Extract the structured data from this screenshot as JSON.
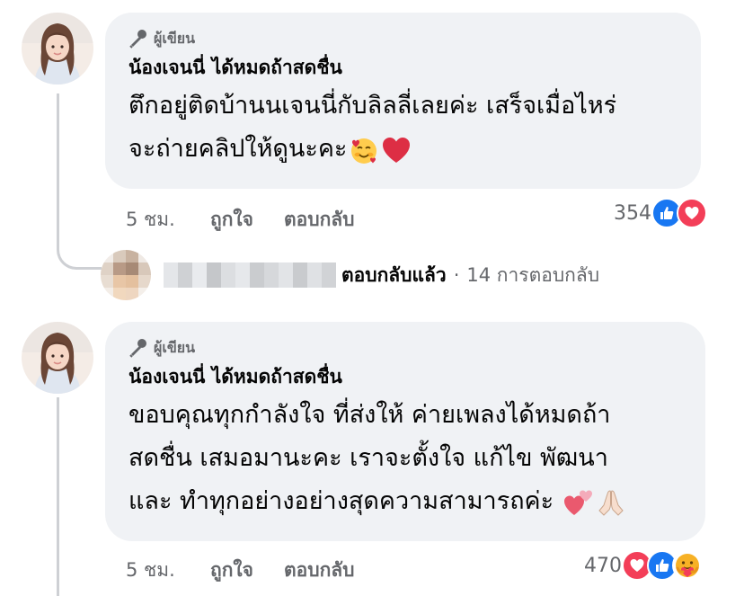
{
  "comments": [
    {
      "author_badge": "ผู้เขียน",
      "author_name": "น้องเจนนี่ ได้หมดถ้าสดชื่น",
      "text_line1": "ตึกอยู่ติดบ้านนเจนนี่กับลิลลี่เลยค่ะ  เสร็จเมื่อไหร่",
      "text_line2": "จะถ่ายคลิปให้ดูนะคะ",
      "emojis": [
        "smiling-face-with-hearts",
        "red-heart"
      ],
      "timestamp": "5 ชม.",
      "like_label": "ถูกใจ",
      "reply_label": "ตอบกลับ",
      "reaction_count": "354",
      "reactions": [
        "like",
        "love"
      ]
    },
    {
      "author_badge": "ผู้เขียน",
      "author_name": "น้องเจนนี่ ได้หมดถ้าสดชื่น",
      "text_line1": "ขอบคุณทุกกำลังใจ ที่ส่งให้ ค่ายเพลงได้หมดถ้า",
      "text_line2": "สดชื่น เสมอมานะคะ เราจะตั้งใจ แก้ไข พัฒนา",
      "text_line3": "และ ทำทุกอย่างอย่างสุดความสามารถค่ะ",
      "emojis": [
        "two-hearts",
        "folded-hands"
      ],
      "timestamp": "5 ชม.",
      "like_label": "ถูกใจ",
      "reply_label": "ตอบกลับ",
      "reaction_count": "470",
      "reactions": [
        "love",
        "like",
        "care"
      ]
    }
  ],
  "reply_summary": {
    "replied_label": "ตอบกลับแล้ว",
    "separator": "·",
    "replies_count_label": "14 การตอบกลับ"
  },
  "colors": {
    "bubble_bg": "#f0f2f5",
    "secondary_text": "#65676b",
    "primary_text": "#050505",
    "like_blue": "#1877f2",
    "love_red": "#f33e58",
    "thread_line": "#ced0d4"
  }
}
